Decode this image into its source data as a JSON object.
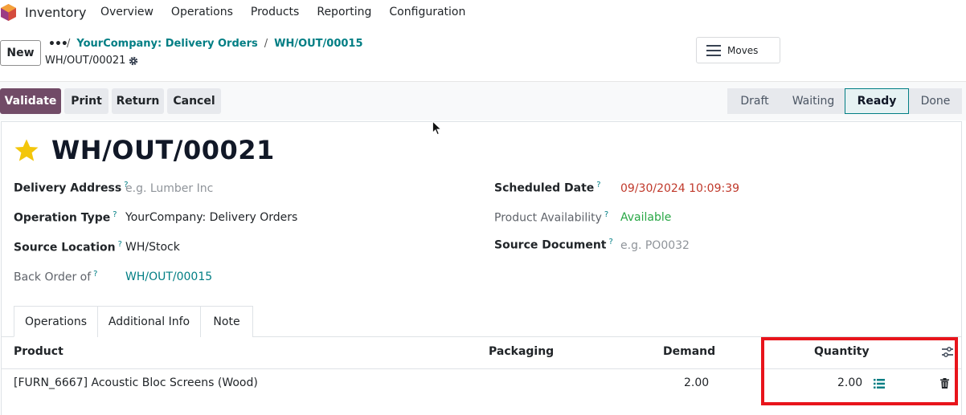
{
  "nav": {
    "app_name": "Inventory",
    "menu": [
      "Overview",
      "Operations",
      "Products",
      "Reporting",
      "Configuration"
    ]
  },
  "control": {
    "new_label": "New",
    "breadcrumb_more": "•••",
    "breadcrumb": [
      "YourCompany: Delivery Orders",
      "WH/OUT/00015"
    ],
    "record_name": "WH/OUT/00021",
    "moves_label": "Moves"
  },
  "actions": [
    "Validate",
    "Print",
    "Return",
    "Cancel"
  ],
  "statusbar": {
    "stages": [
      "Draft",
      "Waiting",
      "Ready",
      "Done"
    ],
    "active": "Ready"
  },
  "form": {
    "title": "WH/OUT/00021",
    "left": {
      "delivery_address_label": "Delivery Address",
      "delivery_address_placeholder": "e.g. Lumber Inc",
      "operation_type_label": "Operation Type",
      "operation_type_value": "YourCompany: Delivery Orders",
      "source_location_label": "Source Location",
      "source_location_value": "WH/Stock",
      "back_order_label": "Back Order of",
      "back_order_value": "WH/OUT/00015"
    },
    "right": {
      "scheduled_date_label": "Scheduled Date",
      "scheduled_date_value": "09/30/2024 10:09:39",
      "product_availability_label": "Product Availability",
      "product_availability_value": "Available",
      "source_document_label": "Source Document",
      "source_document_placeholder": "e.g. PO0032"
    },
    "help_mark": "?"
  },
  "tabs": [
    "Operations",
    "Additional Info",
    "Note"
  ],
  "table": {
    "headers": {
      "product": "Product",
      "packaging": "Packaging",
      "demand": "Demand",
      "quantity": "Quantity"
    },
    "rows": [
      {
        "product": "[FURN_6667] Acoustic Bloc Screens (Wood)",
        "packaging": "",
        "demand": "2.00",
        "quantity": "2.00"
      }
    ]
  },
  "colors": {
    "brand": "#714b67",
    "link": "#017e84",
    "highlight": "#e8141b",
    "star": "#f3c60b"
  }
}
